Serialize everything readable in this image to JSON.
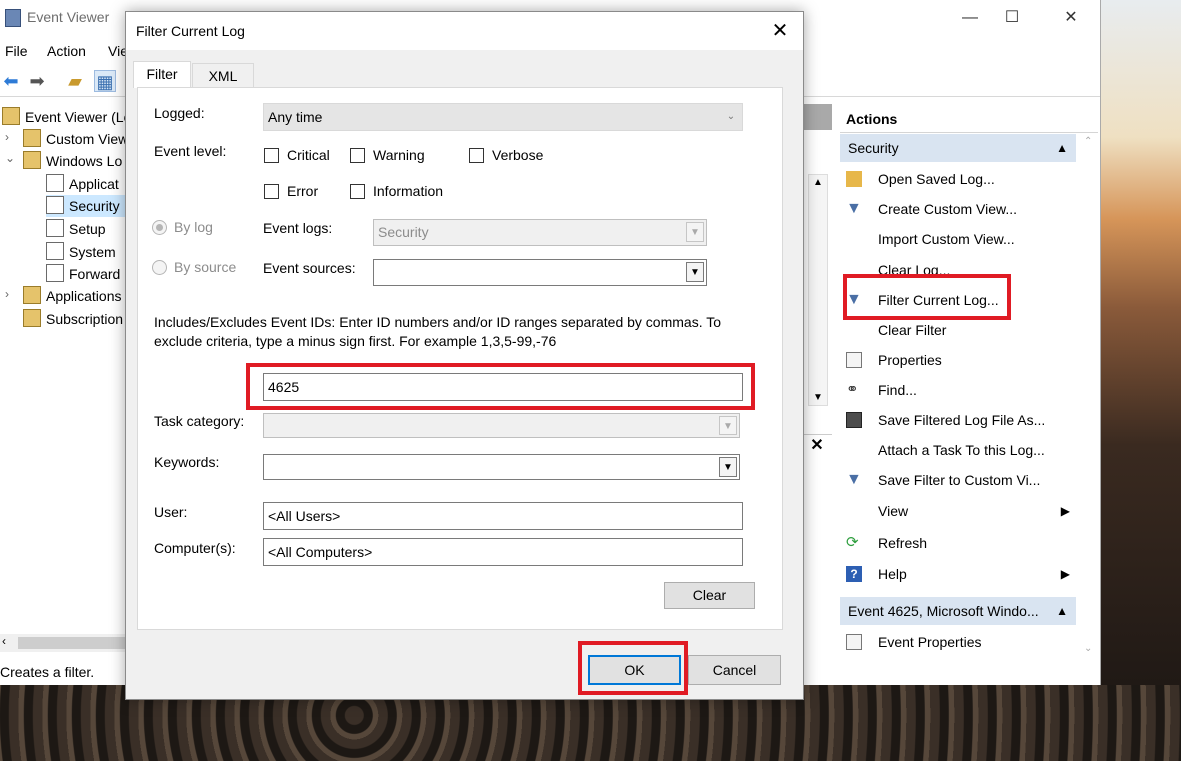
{
  "main_window": {
    "title": "Event Viewer",
    "menu": [
      "File",
      "Action",
      "Vie"
    ],
    "tree": [
      {
        "label": "Event Viewer (Lo",
        "expander": ""
      },
      {
        "label": "Custom View",
        "expander": "›"
      },
      {
        "label": "Windows Lo",
        "expander": "⌄"
      },
      {
        "label": "Applicat",
        "expander": ""
      },
      {
        "label": "Security",
        "expander": ""
      },
      {
        "label": "Setup",
        "expander": ""
      },
      {
        "label": "System",
        "expander": ""
      },
      {
        "label": "Forward",
        "expander": ""
      },
      {
        "label": "Applications",
        "expander": "›"
      },
      {
        "label": "Subscription",
        "expander": ""
      }
    ],
    "status": "Creates a filter."
  },
  "actions_pane": {
    "header": "Actions",
    "section1": "Security",
    "items": [
      {
        "label": "Open Saved Log...",
        "icon": "folder-open-icon"
      },
      {
        "label": "Create Custom View...",
        "icon": "funnel-create-icon"
      },
      {
        "label": "Import Custom View...",
        "icon": ""
      },
      {
        "label": "Clear Log...",
        "icon": ""
      },
      {
        "label": "Filter Current Log...",
        "icon": "funnel-icon"
      },
      {
        "label": "Clear Filter",
        "icon": ""
      },
      {
        "label": "Properties",
        "icon": "properties-icon"
      },
      {
        "label": "Find...",
        "icon": "binoculars-icon"
      },
      {
        "label": "Save Filtered Log File As...",
        "icon": "save-icon"
      },
      {
        "label": "Attach a Task To this Log...",
        "icon": ""
      },
      {
        "label": "Save Filter to Custom Vi...",
        "icon": "funnel-save-icon"
      },
      {
        "label": "View",
        "icon": "",
        "submenu": true
      },
      {
        "label": "Refresh",
        "icon": "refresh-icon"
      },
      {
        "label": "Help",
        "icon": "help-icon",
        "submenu": true
      }
    ],
    "section2": "Event 4625, Microsoft Windo...",
    "section2_items": [
      {
        "label": "Event Properties",
        "icon": "properties-icon"
      }
    ]
  },
  "dialog": {
    "title": "Filter Current Log",
    "tabs": [
      "Filter",
      "XML"
    ],
    "logged_label": "Logged:",
    "logged_value": "Any time",
    "event_level_label": "Event level:",
    "levels": {
      "critical": "Critical",
      "warning": "Warning",
      "verbose": "Verbose",
      "error": "Error",
      "information": "Information"
    },
    "by_log": "By log",
    "by_source": "By source",
    "event_logs_label": "Event logs:",
    "event_logs_value": "Security",
    "event_sources_label": "Event sources:",
    "event_sources_value": "",
    "instructions": "Includes/Excludes Event IDs: Enter ID numbers and/or ID ranges separated by commas. To exclude criteria, type a minus sign first. For example 1,3,5-99,-76",
    "event_ids_value": "4625",
    "task_category_label": "Task category:",
    "keywords_label": "Keywords:",
    "user_label": "User:",
    "user_value": "<All Users>",
    "computer_label": "Computer(s):",
    "computer_value": "<All Computers>",
    "clear_button": "Clear",
    "ok_button": "OK",
    "cancel_button": "Cancel"
  },
  "colors": {
    "highlight": "#e01b24",
    "focus": "#0078d7",
    "section": "#d9e4f1",
    "selection": "#cce8ff"
  }
}
